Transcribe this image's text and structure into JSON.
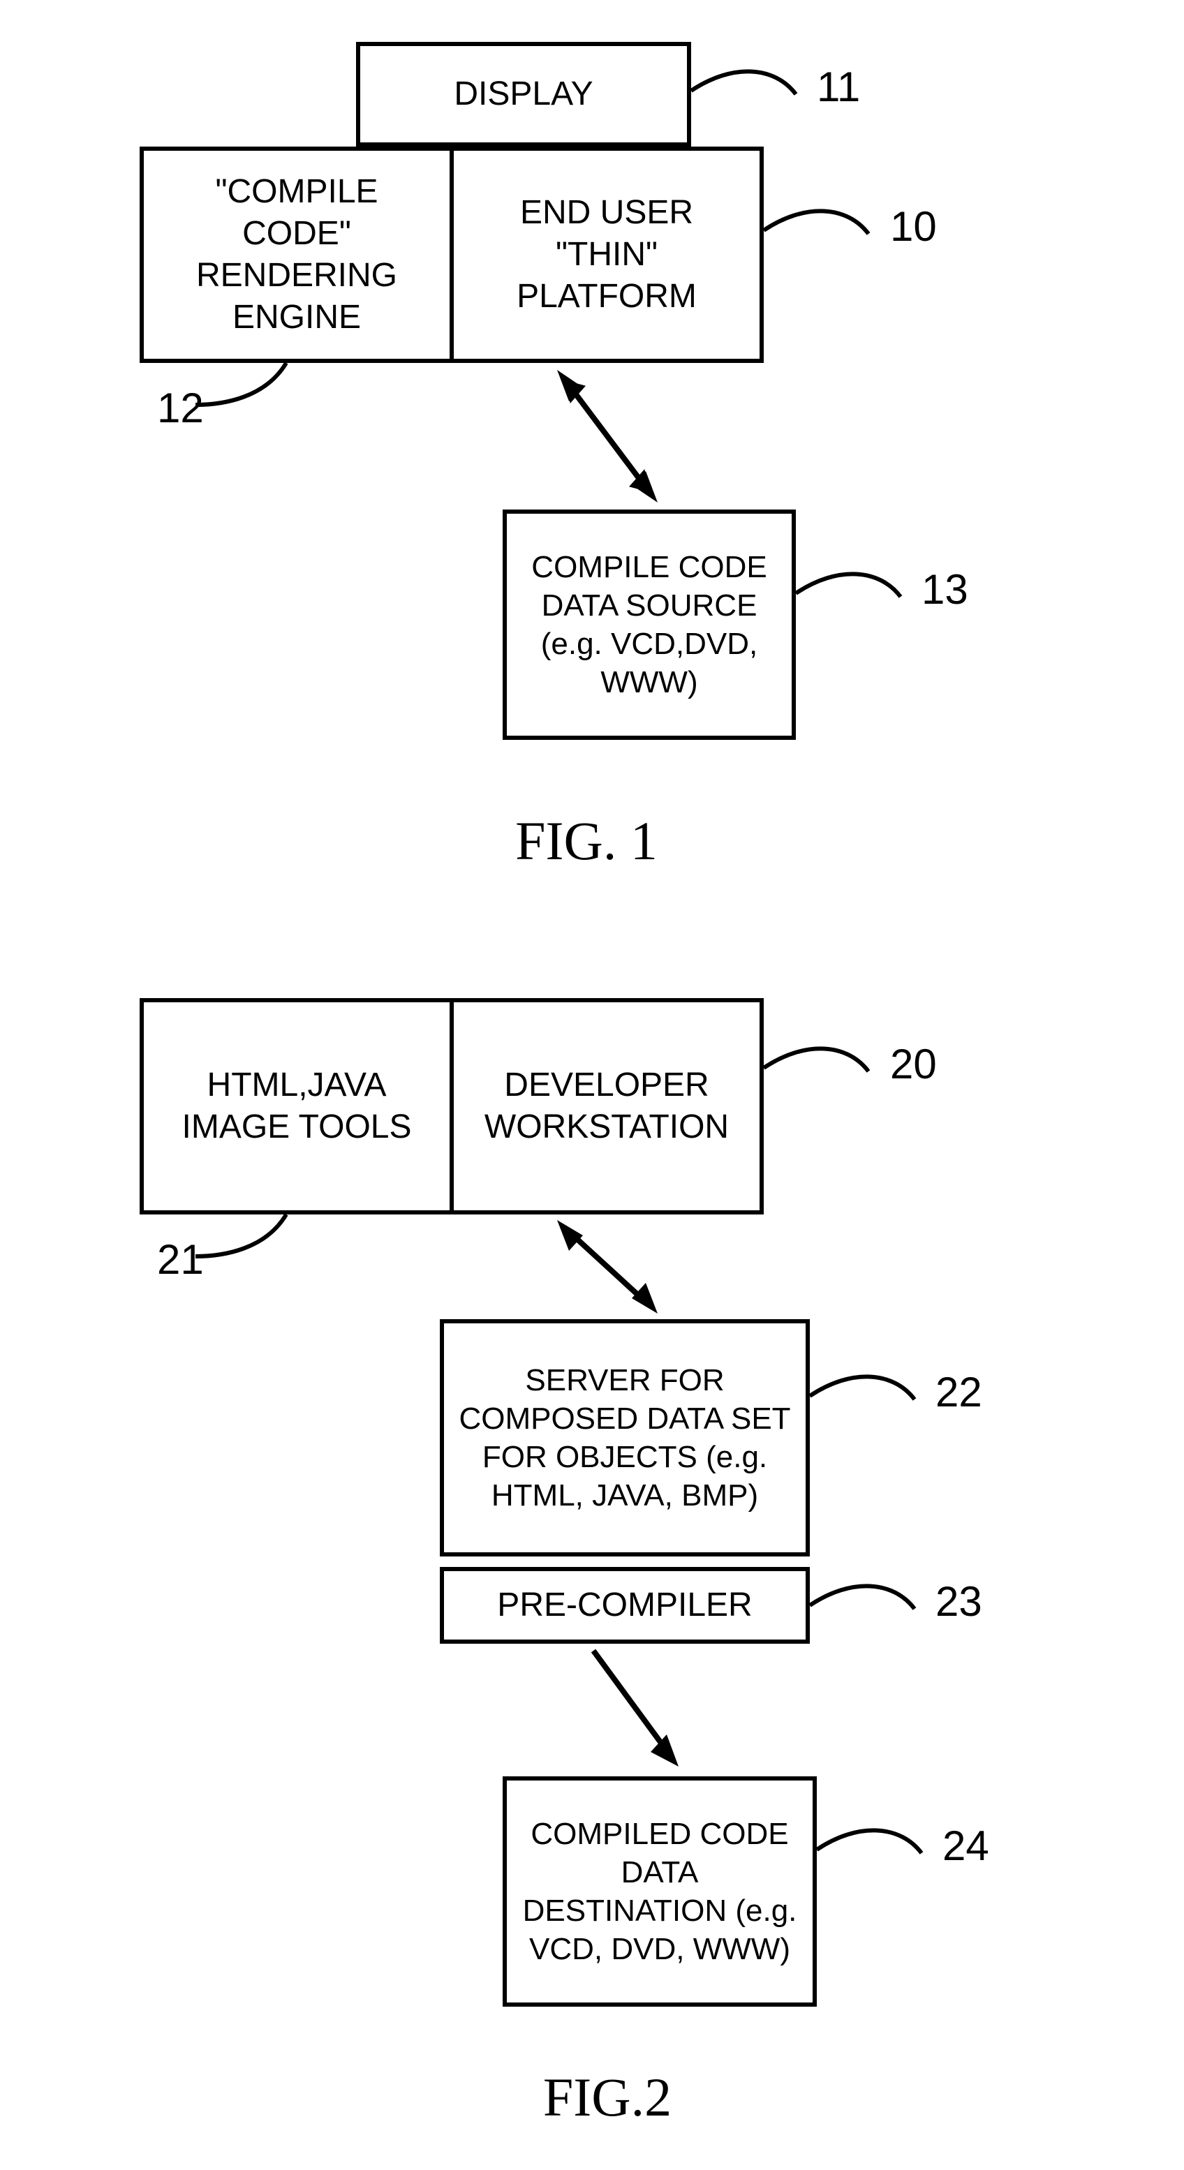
{
  "fig1": {
    "caption": "FIG. 1",
    "boxes": {
      "display": {
        "text": "DISPLAY",
        "ref": "11"
      },
      "engine": {
        "text": "\"COMPILE CODE\" RENDERING ENGINE",
        "ref": "12"
      },
      "platform": {
        "text": "END USER \"THIN\" PLATFORM",
        "ref": "10"
      },
      "source": {
        "text": "COMPILE CODE DATA SOURCE (e.g. VCD,DVD, WWW)",
        "ref": "13"
      }
    }
  },
  "fig2": {
    "caption": "FIG.2",
    "boxes": {
      "tools": {
        "text": "HTML,JAVA IMAGE TOOLS",
        "ref": "21"
      },
      "workstation": {
        "text": "DEVELOPER WORKSTATION",
        "ref": "20"
      },
      "server": {
        "text": "SERVER FOR COMPOSED DATA SET FOR OBJECTS (e.g. HTML, JAVA, BMP)",
        "ref": "22"
      },
      "precompiler": {
        "text": "PRE-COMPILER",
        "ref": "23"
      },
      "dest": {
        "text": "COMPILED CODE DATA DESTINATION (e.g. VCD, DVD, WWW)",
        "ref": "24"
      }
    }
  }
}
